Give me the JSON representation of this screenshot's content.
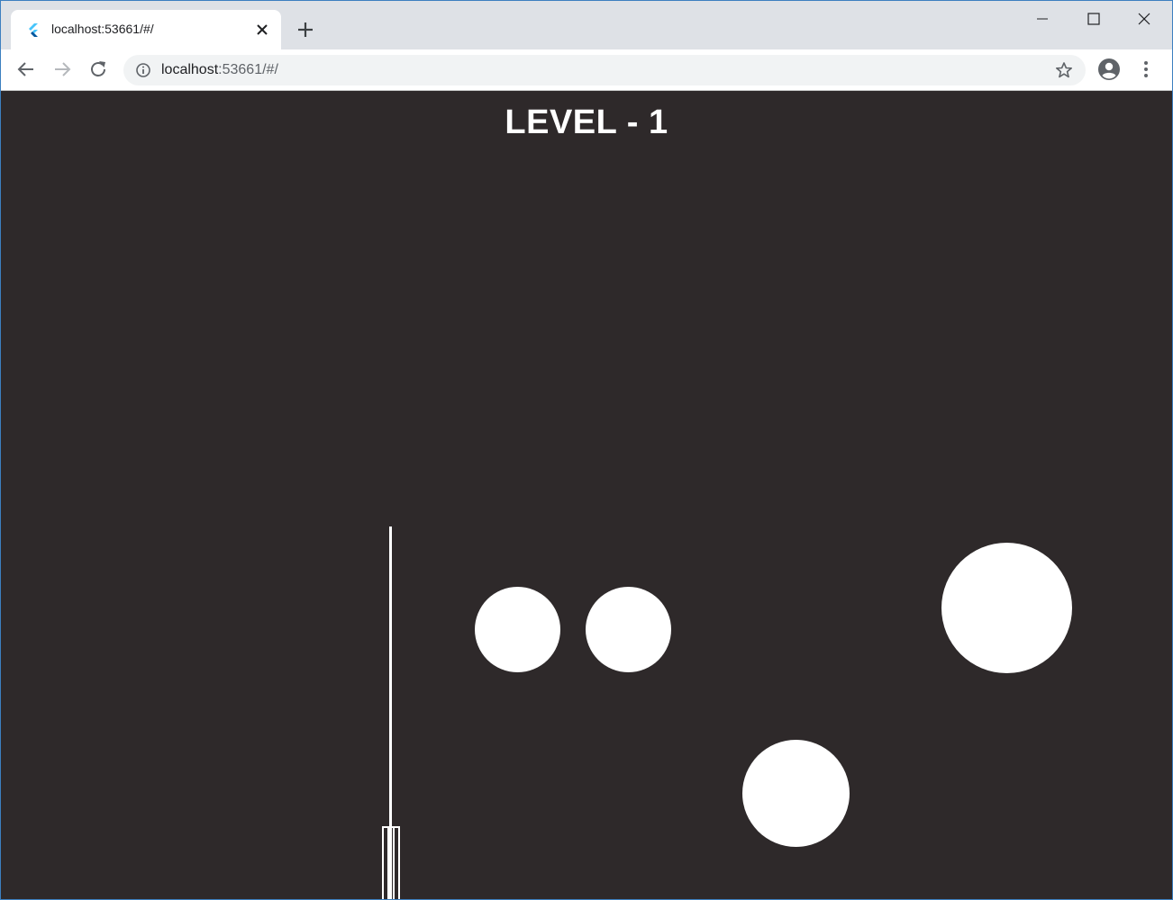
{
  "browser": {
    "tab": {
      "title": "localhost:53661/#/",
      "favicon": "flutter-icon"
    },
    "address_bar": {
      "url_host": "localhost",
      "url_rest": ":53661/#/"
    },
    "icons": {
      "back": "arrow-left-icon",
      "forward": "arrow-right-icon",
      "reload": "reload-icon",
      "info": "info-icon",
      "bookmark": "star-icon",
      "profile": "account-circle-icon",
      "menu": "more-vert-icon",
      "new_tab": "plus-icon",
      "tab_close": "close-icon",
      "window_minimize": "minimize-icon",
      "window_maximize": "maximize-icon",
      "window_close": "close-icon"
    }
  },
  "game": {
    "level_title": "LEVEL - 1",
    "background_color": "#2e292a",
    "ball_color": "#ffffff",
    "balls": [
      {
        "id": "ball-1",
        "size": "medium"
      },
      {
        "id": "ball-2",
        "size": "medium"
      },
      {
        "id": "ball-3",
        "size": "large"
      },
      {
        "id": "ball-4",
        "size": "medium"
      }
    ],
    "harpoon": "harpoon-rope",
    "player": "player-cannon"
  }
}
